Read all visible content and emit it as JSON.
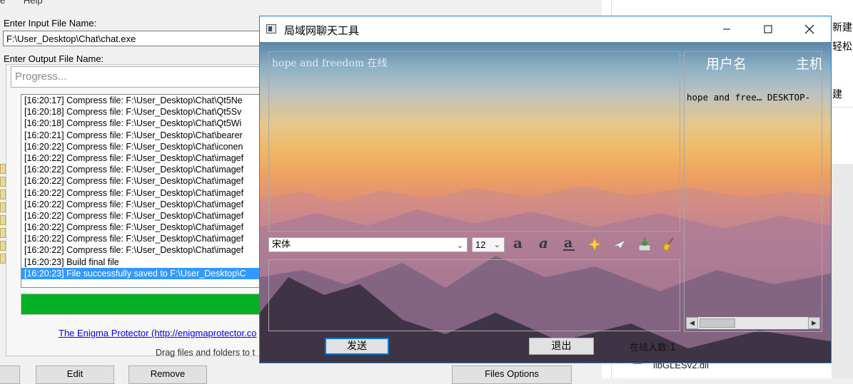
{
  "enigma": {
    "menu": [
      "e",
      "Help"
    ],
    "input_label": "Enter Input File Name:",
    "input_value": "F:\\User_Desktop\\Chat\\chat.exe",
    "output_label": "Enter Output File Name:",
    "progress_placeholder": "Progress...",
    "log": [
      "[16:20:17] Compress file: F:\\User_Desktop\\Chat\\Qt5Ne",
      "[16:20:18] Compress file: F:\\User_Desktop\\Chat\\Qt5Sv",
      "[16:20:18] Compress file: F:\\User_Desktop\\Chat\\Qt5Wi",
      "[16:20:21] Compress file: F:\\User_Desktop\\Chat\\bearer",
      "[16:20:22] Compress file: F:\\User_Desktop\\Chat\\iconen",
      "[16:20:22] Compress file: F:\\User_Desktop\\Chat\\imagef",
      "[16:20:22] Compress file: F:\\User_Desktop\\Chat\\imagef",
      "[16:20:22] Compress file: F:\\User_Desktop\\Chat\\imagef",
      "[16:20:22] Compress file: F:\\User_Desktop\\Chat\\imagef",
      "[16:20:22] Compress file: F:\\User_Desktop\\Chat\\imagef",
      "[16:20:22] Compress file: F:\\User_Desktop\\Chat\\imagef",
      "[16:20:22] Compress file: F:\\User_Desktop\\Chat\\imagef",
      "[16:20:22] Compress file: F:\\User_Desktop\\Chat\\imagef",
      "[16:20:22] Compress file: F:\\User_Desktop\\Chat\\imagef",
      "[16:20:23] Build final file",
      "[16:20:23] File successfully saved to F:\\User_Desktop\\C"
    ],
    "progress_value": 1.0,
    "link": "The Enigma Protector (http://enigmaprotector.co",
    "drag_hint": "Drag files and folders to t",
    "buttons": {
      "edit": "Edit",
      "remove": "Remove",
      "files_options": "Files Options"
    }
  },
  "right_window": {
    "items": [
      "新建",
      "轻松",
      "建"
    ],
    "dll_row": "libGLESv2.dll"
  },
  "chat": {
    "title": "局域网聊天工具",
    "message_line": "hope and freedom 在线",
    "user_header": {
      "col1": "用户名",
      "col2": "主机"
    },
    "user_row": "hope and free… DESKTOP-",
    "font_name": "宋体",
    "font_size": "12",
    "send_label": "发送",
    "quit_label": "退出",
    "status": "在线人数:1",
    "colors": {
      "accent": "#0078d7",
      "progress": "#06b025"
    }
  }
}
